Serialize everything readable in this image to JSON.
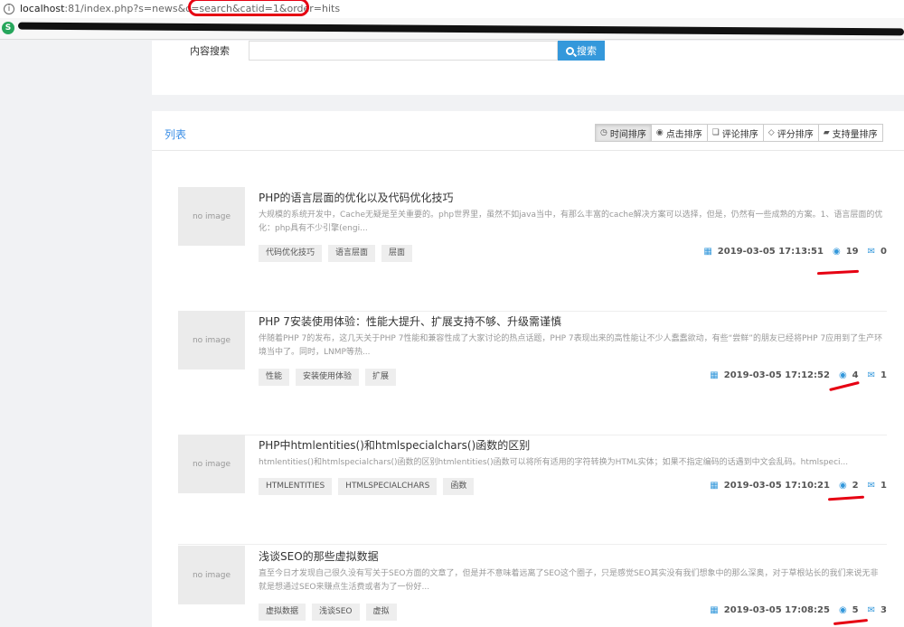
{
  "browser": {
    "url_host": "localhost",
    "url_rest": ":81/index.php?s=news&c=search&catid=1&order=hits"
  },
  "search": {
    "label": "内容搜索",
    "placeholder": "",
    "button_label": "搜索"
  },
  "list": {
    "title": "列表",
    "sort_buttons": [
      {
        "label": "时间排序",
        "icon": "clock-icon",
        "glyph": "◷"
      },
      {
        "label": "点击排序",
        "icon": "eye-icon",
        "glyph": "◉"
      },
      {
        "label": "评论排序",
        "icon": "comment-icon",
        "glyph": "❏"
      },
      {
        "label": "评分排序",
        "icon": "diamond-icon",
        "glyph": "◇"
      },
      {
        "label": "支持量排序",
        "icon": "thumbs-up-icon",
        "glyph": "▰"
      }
    ],
    "thumb_text": "no image",
    "items": [
      {
        "title": "PHP的语言层面的优化以及代码优化技巧",
        "desc": "大规模的系统开发中，Cache无疑是至关重要的。php世界里，虽然不如java当中，有那么丰富的cache解决方案可以选择，但是，仍然有一些成熟的方案。1、语言层面的优化：php具有不少引擎(engi...",
        "tags": [
          "代码优化技巧",
          "语言层面",
          "层面"
        ],
        "date": "2019-03-05 17:13:51",
        "hits": "19",
        "comments": "0"
      },
      {
        "title": "PHP 7安装使用体验：性能大提升、扩展支持不够、升级需谨慎",
        "desc": "伴随着PHP 7的发布，这几天关于PHP 7性能和兼容性成了大家讨论的热点话题，PHP 7表现出来的高性能让不少人蠢蠢欲动，有些“尝鲜”的朋友已经将PHP 7应用到了生产环境当中了。同时，LNMP等热...",
        "tags": [
          "性能",
          "安装使用体验",
          "扩展"
        ],
        "date": "2019-03-05 17:12:52",
        "hits": "4",
        "comments": "1"
      },
      {
        "title": "PHP中htmlentities()和htmlspecialchars()函数的区别",
        "desc": "htmlentities()和htmlspecialchars()函数的区别htmlentities()函数可以将所有适用的字符转换为HTML实体；如果不指定编码的话遇到中文会乱码。htmlspeci...",
        "tags": [
          "HTMLENTITIES",
          "HTMLSPECIALCHARS",
          "函数"
        ],
        "date": "2019-03-05 17:10:21",
        "hits": "2",
        "comments": "1"
      },
      {
        "title": "浅谈SEO的那些虚拟数据",
        "desc": "直至今日才发现自己很久没有写关于SEO方面的文章了，但是并不意味着远离了SEO这个圈子，只是感觉SEO其实没有我们想象中的那么深奥，对于草根站长的我们来说无非就是想通过SEO来赚点生活费或者为了一份好...",
        "tags": [
          "虚拟数据",
          "浅谈SEO",
          "虚拟"
        ],
        "date": "2019-03-05 17:08:25",
        "hits": "5",
        "comments": "3"
      }
    ]
  }
}
